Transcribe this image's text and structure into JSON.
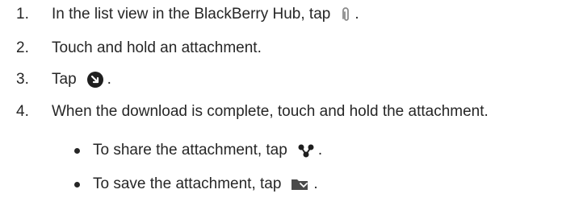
{
  "steps": [
    {
      "number": "1.",
      "text": "In the list view in the BlackBerry Hub, tap",
      "icon": "paperclip-icon",
      "after": "."
    },
    {
      "number": "2.",
      "text": "Touch and hold an attachment."
    },
    {
      "number": "3.",
      "text": "Tap",
      "icon": "download-icon",
      "after": "."
    },
    {
      "number": "4.",
      "text": "When the download is complete, touch and hold the attachment."
    }
  ],
  "bullets": [
    {
      "text": "To share the attachment, tap",
      "icon": "share-icon",
      "after": "."
    },
    {
      "text": "To save the attachment, tap",
      "icon": "save-folder-icon",
      "after": "."
    }
  ]
}
